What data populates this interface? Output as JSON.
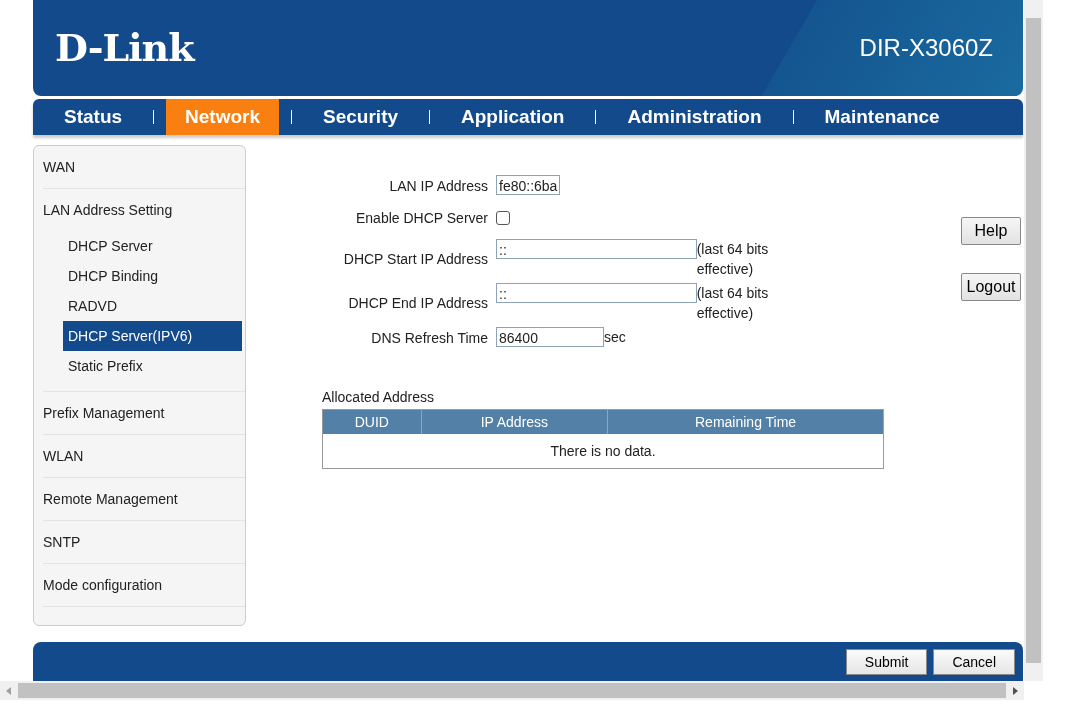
{
  "header": {
    "logo": "D-Link",
    "model": "DIR-X3060Z"
  },
  "nav": [
    {
      "label": "Status",
      "selected": false
    },
    {
      "label": "Network",
      "selected": true
    },
    {
      "label": "Security",
      "selected": false
    },
    {
      "label": "Application",
      "selected": false
    },
    {
      "label": "Administration",
      "selected": false
    },
    {
      "label": "Maintenance",
      "selected": false
    }
  ],
  "sidebar": [
    {
      "label": "WAN",
      "selected": false
    },
    {
      "label": "LAN Address Setting",
      "selected": false,
      "children": [
        {
          "label": "DHCP Server",
          "selected": false
        },
        {
          "label": "DHCP Binding",
          "selected": false
        },
        {
          "label": "RADVD",
          "selected": false
        },
        {
          "label": "DHCP Server(IPV6)",
          "selected": true
        },
        {
          "label": "Static Prefix",
          "selected": false
        }
      ]
    },
    {
      "label": "Prefix Management",
      "selected": false
    },
    {
      "label": "WLAN",
      "selected": false
    },
    {
      "label": "Remote Management",
      "selected": false
    },
    {
      "label": "SNTP",
      "selected": false
    },
    {
      "label": "Mode configuration",
      "selected": false
    }
  ],
  "form": [
    {
      "kind": "text",
      "label": "LAN IP Address",
      "value": "fe80::6ba"
    },
    {
      "kind": "checkbox",
      "label": "Enable DHCP Server",
      "checked": false
    },
    {
      "kind": "text",
      "label": "DHCP Start IP Address",
      "value": "::",
      "note": "(last 64 bits effective)"
    },
    {
      "kind": "text",
      "label": "DHCP End IP Address",
      "value": "::",
      "note": "(last 64 bits effective)"
    },
    {
      "kind": "text",
      "label": "DNS Refresh Time",
      "value": "86400",
      "unit": "sec"
    }
  ],
  "side_buttons": [
    "Help",
    "Logout"
  ],
  "allocated": {
    "title": "Allocated Address",
    "columns": [
      "DUID",
      "IP Address",
      "Remaining Time"
    ],
    "empty": "There is no data."
  },
  "footer_buttons": [
    "Submit",
    "Cancel"
  ]
}
